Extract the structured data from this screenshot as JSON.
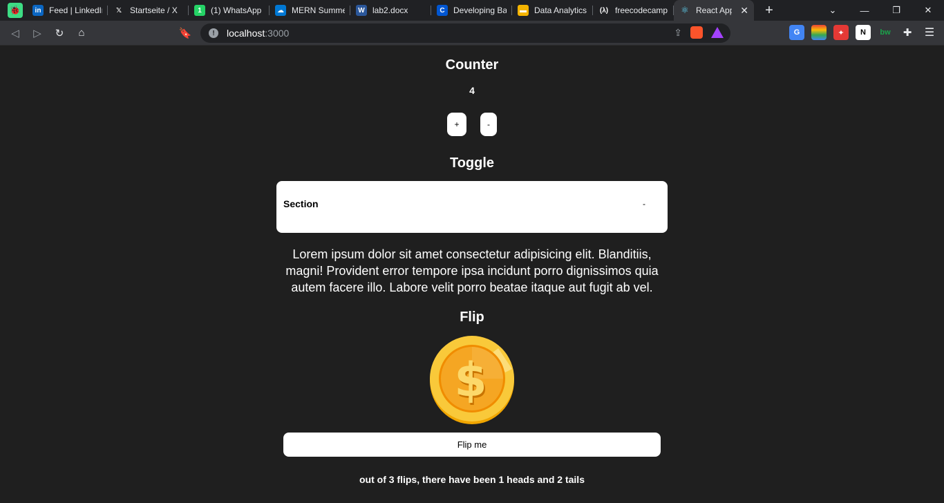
{
  "browser": {
    "tabs": [
      {
        "label": "Feed | LinkedIn",
        "icon": "linkedin-icon",
        "icon_text": "in",
        "color": "#0a66c2"
      },
      {
        "label": "Startseite / X",
        "icon": "x-icon",
        "icon_text": "𝕏",
        "color": "#202124"
      },
      {
        "label": "(1) WhatsApp",
        "icon": "whatsapp-icon",
        "icon_text": "1",
        "color": "#25d366"
      },
      {
        "label": "MERN Summer",
        "icon": "onedrive-icon",
        "icon_text": "☁",
        "color": "#0078d4"
      },
      {
        "label": "lab2.docx",
        "icon": "word-icon",
        "icon_text": "W",
        "color": "#2b579a"
      },
      {
        "label": "Developing Ba",
        "icon": "coursera-icon",
        "icon_text": "C",
        "color": "#0056d2"
      },
      {
        "label": "Data Analytics",
        "icon": "slides-icon",
        "icon_text": "▬",
        "color": "#f4b400"
      },
      {
        "label": "freecodecamp.",
        "icon": "freecodecamp-icon",
        "icon_text": "(λ)",
        "color": "#202124"
      }
    ],
    "active_tab": {
      "label": "React App",
      "icon": "react-icon"
    },
    "address": {
      "host": "localhost",
      "port": ":3000"
    }
  },
  "counter": {
    "title": "Counter",
    "value": "4",
    "increment_label": "+",
    "decrement_label": "-"
  },
  "toggle": {
    "title": "Toggle",
    "section_label": "Section",
    "toggle_sign": "-",
    "content": "Lorem ipsum dolor sit amet consectetur adipisicing elit. Blanditiis, magni! Provident error tempore ipsa incidunt porro dignissimos quia autem facere illo. Labore velit porro beatae itaque aut fugit ab vel."
  },
  "flip": {
    "title": "Flip",
    "coin_side": "heads",
    "button_label": "Flip me",
    "summary": "out of 3 flips, there have been 1 heads and 2 tails"
  },
  "colors": {
    "page_bg": "#1f1f1f",
    "card_bg": "#ffffff",
    "coin_gold": "#f5b324"
  }
}
